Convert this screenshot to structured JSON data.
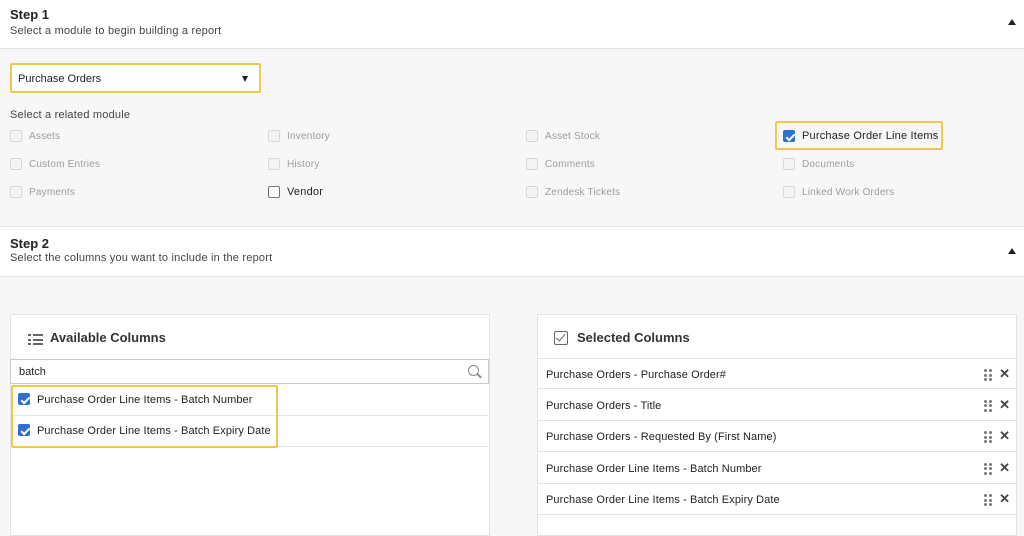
{
  "step1": {
    "title": "Step 1",
    "subtitle": "Select a module to begin building a report",
    "module_select": {
      "value": "Purchase Orders"
    },
    "related_label": "Select a related module",
    "related_modules": [
      {
        "label": "Assets",
        "checked": false,
        "enabled": false
      },
      {
        "label": "Inventory",
        "checked": false,
        "enabled": false
      },
      {
        "label": "Asset Stock",
        "checked": false,
        "enabled": false
      },
      {
        "label": "Purchase Order Line Items",
        "checked": true,
        "enabled": true
      },
      {
        "label": "Custom Entries",
        "checked": false,
        "enabled": false
      },
      {
        "label": "History",
        "checked": false,
        "enabled": false
      },
      {
        "label": "Comments",
        "checked": false,
        "enabled": false
      },
      {
        "label": "Documents",
        "checked": false,
        "enabled": false
      },
      {
        "label": "Payments",
        "checked": false,
        "enabled": false
      },
      {
        "label": "Vendor",
        "checked": false,
        "enabled": true
      },
      {
        "label": "Zendesk Tickets",
        "checked": false,
        "enabled": false
      },
      {
        "label": "Linked Work Orders",
        "checked": false,
        "enabled": false
      }
    ]
  },
  "step2": {
    "title": "Step 2",
    "subtitle": "Select the columns you want to include in the report",
    "available": {
      "title": "Available Columns",
      "search_value": "batch",
      "items": [
        {
          "label": "Purchase Order Line Items - Batch Number",
          "checked": true
        },
        {
          "label": "Purchase Order Line Items - Batch Expiry Date",
          "checked": true
        }
      ]
    },
    "selected": {
      "title": "Selected Columns",
      "items": [
        {
          "label": "Purchase Orders - Purchase Order#"
        },
        {
          "label": "Purchase Orders - Title"
        },
        {
          "label": "Purchase Orders - Requested By (First Name)"
        },
        {
          "label": "Purchase Order Line Items - Batch Number"
        },
        {
          "label": "Purchase Order Line Items - Batch Expiry Date"
        }
      ],
      "remove_glyph": "✕"
    }
  },
  "colors": {
    "highlight": "#f0c94a",
    "checkbox_checked": "#2f6fd0"
  },
  "icons": {
    "collapse": "caret-up-icon",
    "dropdown": "caret-down-icon",
    "available": "list-icon",
    "selected": "check-square-icon",
    "search": "search-icon",
    "drag": "drag-handle-icon",
    "remove": "close-icon"
  }
}
